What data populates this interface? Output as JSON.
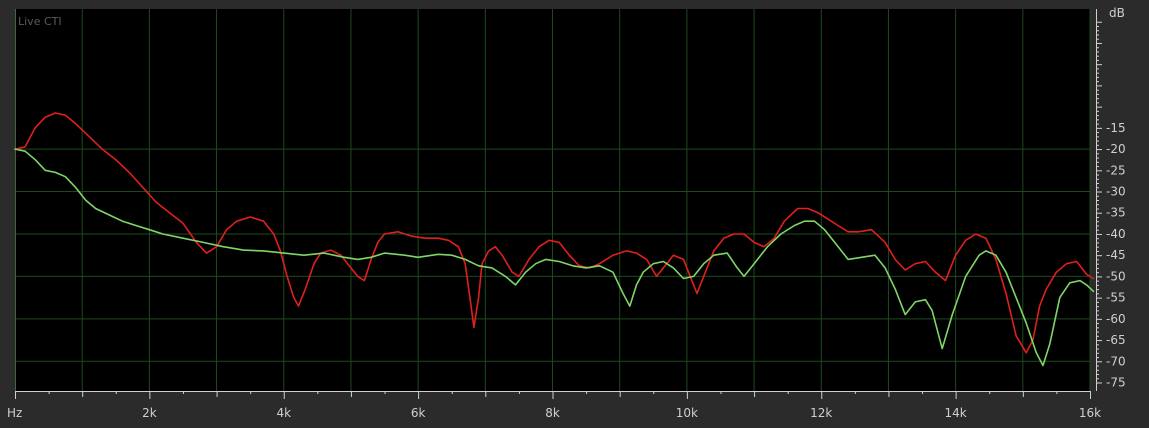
{
  "chart_data": {
    "type": "line",
    "title": "Live CTI",
    "x_unit_label": "Hz",
    "y_unit_label": "dB",
    "xlim": [
      0,
      16000
    ],
    "ylim": [
      -77,
      13
    ],
    "grid": true,
    "x_major_ticks": [
      {
        "value": 2000,
        "label": "2k"
      },
      {
        "value": 4000,
        "label": "4k"
      },
      {
        "value": 6000,
        "label": "6k"
      },
      {
        "value": 8000,
        "label": "8k"
      },
      {
        "value": 10000,
        "label": "10k"
      },
      {
        "value": 12000,
        "label": "12k"
      },
      {
        "value": 14000,
        "label": "14k"
      },
      {
        "value": 16000,
        "label": "16k"
      }
    ],
    "x_minor_ticks": [
      1000,
      3000,
      5000,
      7000,
      9000,
      11000,
      13000,
      15000
    ],
    "y_ticks": [
      -15,
      -20,
      -25,
      -30,
      -35,
      -40,
      -45,
      -50,
      -55,
      -60,
      -65,
      -70,
      -75
    ],
    "colors": {
      "background": "#2b2b2b",
      "plot_bg": "#000000",
      "grid": "#1d4a1d",
      "axis": "#d0d0d0",
      "text": "#cfcfcf",
      "title": "#5a5a5a"
    },
    "series": [
      {
        "color": "#e0201c",
        "points": [
          [
            0,
            -20
          ],
          [
            150,
            -19.5
          ],
          [
            300,
            -15
          ],
          [
            450,
            -12.5
          ],
          [
            600,
            -11.5
          ],
          [
            750,
            -12
          ],
          [
            900,
            -14
          ],
          [
            1100,
            -17
          ],
          [
            1300,
            -20
          ],
          [
            1500,
            -22.5
          ],
          [
            1700,
            -25.5
          ],
          [
            1900,
            -29
          ],
          [
            2100,
            -32.5
          ],
          [
            2300,
            -35
          ],
          [
            2500,
            -37.5
          ],
          [
            2700,
            -42
          ],
          [
            2850,
            -44.5
          ],
          [
            3000,
            -43
          ],
          [
            3150,
            -39
          ],
          [
            3300,
            -37
          ],
          [
            3500,
            -36
          ],
          [
            3700,
            -37
          ],
          [
            3850,
            -40
          ],
          [
            3950,
            -44
          ],
          [
            4050,
            -50
          ],
          [
            4150,
            -55
          ],
          [
            4220,
            -57
          ],
          [
            4320,
            -53
          ],
          [
            4450,
            -47
          ],
          [
            4550,
            -44.5
          ],
          [
            4700,
            -43.8
          ],
          [
            4850,
            -45
          ],
          [
            5000,
            -48
          ],
          [
            5100,
            -50
          ],
          [
            5200,
            -51
          ],
          [
            5300,
            -46
          ],
          [
            5400,
            -42
          ],
          [
            5500,
            -40
          ],
          [
            5700,
            -39.5
          ],
          [
            5900,
            -40.5
          ],
          [
            6100,
            -41
          ],
          [
            6300,
            -41
          ],
          [
            6450,
            -41.5
          ],
          [
            6600,
            -43
          ],
          [
            6700,
            -47
          ],
          [
            6780,
            -56
          ],
          [
            6830,
            -62
          ],
          [
            6900,
            -55
          ],
          [
            6950,
            -47
          ],
          [
            7050,
            -44
          ],
          [
            7150,
            -43
          ],
          [
            7250,
            -45
          ],
          [
            7400,
            -49
          ],
          [
            7500,
            -50
          ],
          [
            7650,
            -46
          ],
          [
            7800,
            -43
          ],
          [
            7950,
            -41.5
          ],
          [
            8100,
            -42
          ],
          [
            8250,
            -45
          ],
          [
            8400,
            -47.5
          ],
          [
            8550,
            -48
          ],
          [
            8700,
            -47
          ],
          [
            8900,
            -45
          ],
          [
            9100,
            -44
          ],
          [
            9250,
            -44.5
          ],
          [
            9400,
            -46
          ],
          [
            9550,
            -50
          ],
          [
            9650,
            -48
          ],
          [
            9800,
            -45
          ],
          [
            9950,
            -46
          ],
          [
            10050,
            -50
          ],
          [
            10150,
            -54
          ],
          [
            10250,
            -50
          ],
          [
            10400,
            -44
          ],
          [
            10550,
            -41
          ],
          [
            10700,
            -40
          ],
          [
            10850,
            -40
          ],
          [
            11000,
            -42
          ],
          [
            11150,
            -43
          ],
          [
            11300,
            -41
          ],
          [
            11450,
            -37
          ],
          [
            11650,
            -34
          ],
          [
            11800,
            -34
          ],
          [
            11950,
            -35
          ],
          [
            12100,
            -36.5
          ],
          [
            12250,
            -38
          ],
          [
            12400,
            -39.5
          ],
          [
            12550,
            -39.5
          ],
          [
            12750,
            -39
          ],
          [
            12950,
            -42
          ],
          [
            13100,
            -46
          ],
          [
            13250,
            -48.5
          ],
          [
            13400,
            -47
          ],
          [
            13550,
            -46.5
          ],
          [
            13700,
            -49
          ],
          [
            13850,
            -51
          ],
          [
            14000,
            -45
          ],
          [
            14150,
            -41.5
          ],
          [
            14300,
            -40
          ],
          [
            14450,
            -41
          ],
          [
            14600,
            -46
          ],
          [
            14750,
            -54
          ],
          [
            14900,
            -64
          ],
          [
            15050,
            -68
          ],
          [
            15150,
            -65
          ],
          [
            15250,
            -57
          ],
          [
            15350,
            -53
          ],
          [
            15500,
            -49
          ],
          [
            15650,
            -47
          ],
          [
            15800,
            -46.5
          ],
          [
            15950,
            -49.5
          ],
          [
            16050,
            -50.5
          ]
        ]
      },
      {
        "color": "#7fd667",
        "points": [
          [
            0,
            -20
          ],
          [
            150,
            -20.5
          ],
          [
            300,
            -22.5
          ],
          [
            450,
            -25
          ],
          [
            600,
            -25.5
          ],
          [
            750,
            -26.5
          ],
          [
            900,
            -29
          ],
          [
            1050,
            -32
          ],
          [
            1200,
            -34
          ],
          [
            1400,
            -35.5
          ],
          [
            1600,
            -37
          ],
          [
            1800,
            -38
          ],
          [
            2000,
            -39
          ],
          [
            2200,
            -40
          ],
          [
            2500,
            -41
          ],
          [
            2800,
            -42
          ],
          [
            3100,
            -43
          ],
          [
            3400,
            -43.8
          ],
          [
            3700,
            -44
          ],
          [
            4000,
            -44.5
          ],
          [
            4300,
            -45
          ],
          [
            4600,
            -44.5
          ],
          [
            4900,
            -45.5
          ],
          [
            5100,
            -46
          ],
          [
            5300,
            -45.5
          ],
          [
            5500,
            -44.5
          ],
          [
            5800,
            -45
          ],
          [
            6000,
            -45.5
          ],
          [
            6300,
            -44.8
          ],
          [
            6500,
            -45
          ],
          [
            6700,
            -46
          ],
          [
            6900,
            -47.5
          ],
          [
            7100,
            -48
          ],
          [
            7300,
            -50
          ],
          [
            7450,
            -52
          ],
          [
            7600,
            -49
          ],
          [
            7750,
            -47
          ],
          [
            7900,
            -46
          ],
          [
            8100,
            -46.5
          ],
          [
            8300,
            -47.5
          ],
          [
            8500,
            -48
          ],
          [
            8700,
            -47.5
          ],
          [
            8900,
            -49
          ],
          [
            9050,
            -54
          ],
          [
            9150,
            -57
          ],
          [
            9250,
            -52
          ],
          [
            9350,
            -49
          ],
          [
            9500,
            -47
          ],
          [
            9650,
            -46.5
          ],
          [
            9800,
            -48
          ],
          [
            9950,
            -50.5
          ],
          [
            10100,
            -50
          ],
          [
            10250,
            -47
          ],
          [
            10400,
            -45
          ],
          [
            10600,
            -44.5
          ],
          [
            10750,
            -48
          ],
          [
            10850,
            -50
          ],
          [
            11000,
            -47
          ],
          [
            11200,
            -43
          ],
          [
            11400,
            -40
          ],
          [
            11600,
            -38
          ],
          [
            11750,
            -37
          ],
          [
            11900,
            -37
          ],
          [
            12050,
            -39
          ],
          [
            12200,
            -42
          ],
          [
            12400,
            -46
          ],
          [
            12600,
            -45.5
          ],
          [
            12800,
            -45
          ],
          [
            12950,
            -48
          ],
          [
            13100,
            -53
          ],
          [
            13250,
            -59
          ],
          [
            13400,
            -56
          ],
          [
            13550,
            -55.5
          ],
          [
            13650,
            -58
          ],
          [
            13800,
            -67
          ],
          [
            13950,
            -59
          ],
          [
            14150,
            -50
          ],
          [
            14350,
            -45
          ],
          [
            14450,
            -44
          ],
          [
            14600,
            -45
          ],
          [
            14750,
            -49
          ],
          [
            14900,
            -55
          ],
          [
            15050,
            -61
          ],
          [
            15200,
            -68
          ],
          [
            15300,
            -71
          ],
          [
            15400,
            -66
          ],
          [
            15550,
            -55
          ],
          [
            15700,
            -51.5
          ],
          [
            15850,
            -51
          ],
          [
            15950,
            -52
          ],
          [
            16050,
            -53.5
          ]
        ]
      }
    ]
  }
}
